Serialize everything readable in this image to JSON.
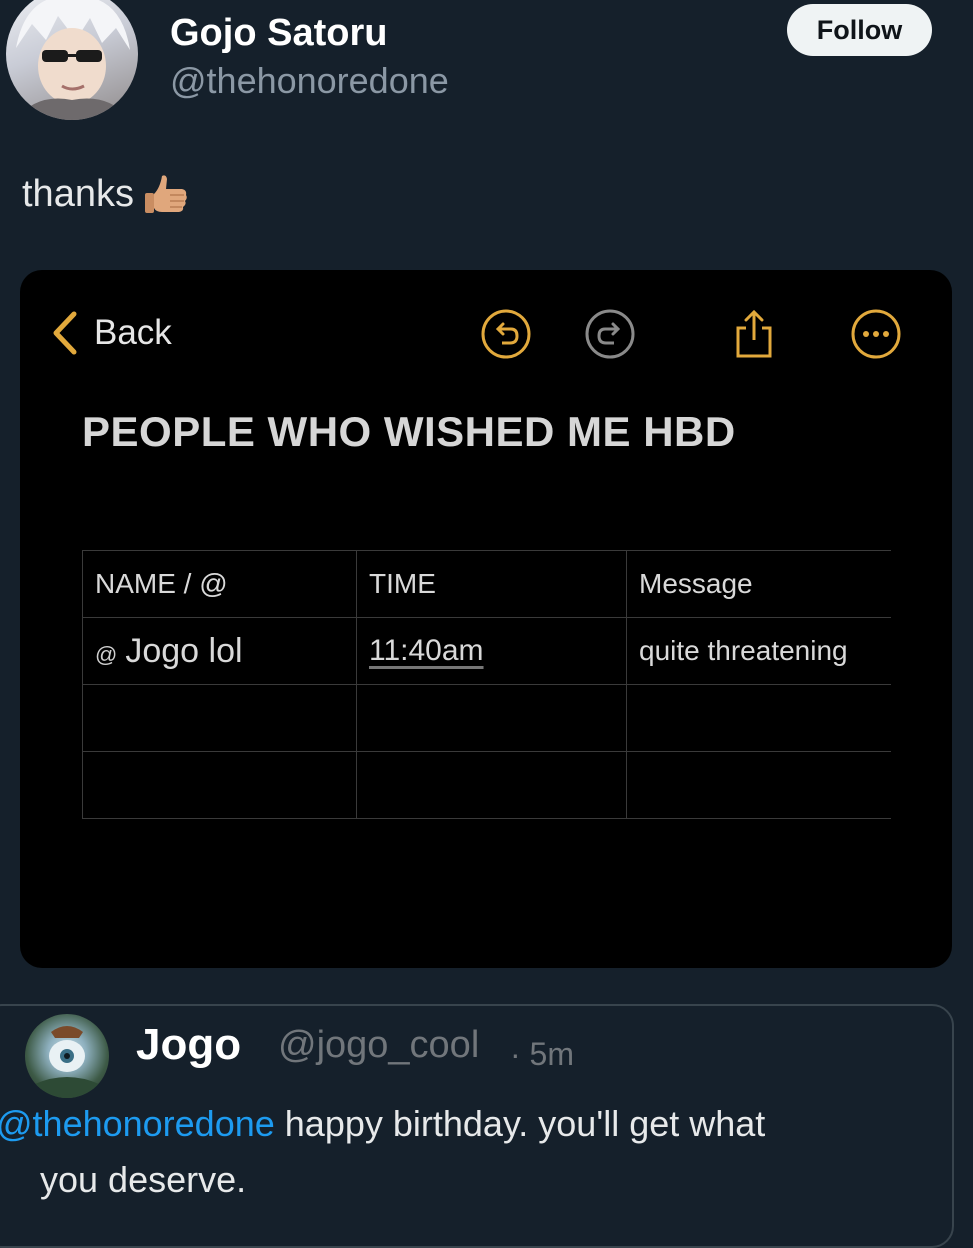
{
  "author": {
    "display_name": "Gojo Satoru",
    "handle": "@thehonoredone",
    "follow_label": "Follow"
  },
  "tweet": {
    "text": "thanks",
    "emoji": "thumbs-up-icon"
  },
  "note": {
    "back_label": "Back",
    "title": "PEOPLE WHO WISHED ME HBD",
    "toolbar_icons": [
      "undo-icon",
      "redo-icon",
      "share-icon",
      "more-icon"
    ],
    "accent": "#e2a93c",
    "table": {
      "headers": [
        "NAME / @",
        "TIME",
        "Message"
      ],
      "rows": [
        {
          "at": "@",
          "name": "Jogo lol",
          "time": "11:40am",
          "message": "quite threatening"
        },
        {
          "at": "",
          "name": "",
          "time": "",
          "message": ""
        },
        {
          "at": "",
          "name": "",
          "time": "",
          "message": ""
        }
      ]
    }
  },
  "reply": {
    "display_name": "Jogo",
    "handle": "@jogo_cool",
    "time": "· 5m",
    "mention": "@thehonoredone",
    "text_line1": " happy birthday. you'll get what",
    "text_line2": "you deserve."
  }
}
